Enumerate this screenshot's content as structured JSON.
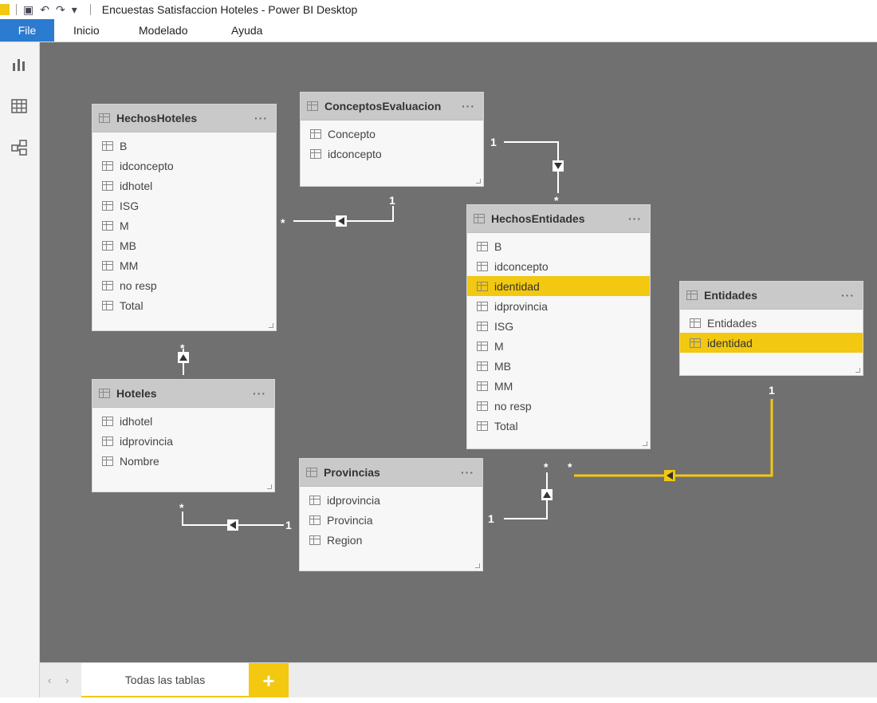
{
  "window": {
    "title": "Encuestas Satisfaccion Hoteles - Power BI Desktop"
  },
  "ribbon": {
    "tabs": [
      "File",
      "Inicio",
      "Modelado",
      "Ayuda"
    ]
  },
  "left_rail": {
    "icons": [
      "report-view-icon",
      "data-view-icon",
      "model-view-icon"
    ]
  },
  "tables": [
    {
      "name": "HechosHoteles",
      "fields": [
        "B",
        "idconcepto",
        "idhotel",
        "ISG",
        "M",
        "MB",
        "MM",
        "no resp",
        "Total"
      ],
      "selected": []
    },
    {
      "name": "ConceptosEvaluacion",
      "fields": [
        "Concepto",
        "idconcepto"
      ],
      "selected": []
    },
    {
      "name": "HechosEntidades",
      "fields": [
        "B",
        "idconcepto",
        "identidad",
        "idprovincia",
        "ISG",
        "M",
        "MB",
        "MM",
        "no resp",
        "Total"
      ],
      "selected": [
        "identidad"
      ]
    },
    {
      "name": "Entidades",
      "fields": [
        "Entidades",
        "identidad"
      ],
      "selected": [
        "identidad"
      ]
    },
    {
      "name": "Hoteles",
      "fields": [
        "idhotel",
        "idprovincia",
        "Nombre"
      ],
      "selected": []
    },
    {
      "name": "Provincias",
      "fields": [
        "idprovincia",
        "Provincia",
        "Region"
      ],
      "selected": []
    }
  ],
  "card_more": "···",
  "relationships": {
    "one": "1",
    "many": "*"
  },
  "bottom": {
    "page_tab": "Todas las tablas",
    "add_label": "+",
    "prev": "‹",
    "next": "›"
  },
  "colors": {
    "accent": "#f2c811",
    "canvas": "#707070",
    "file_tab": "#2b7bd0"
  }
}
